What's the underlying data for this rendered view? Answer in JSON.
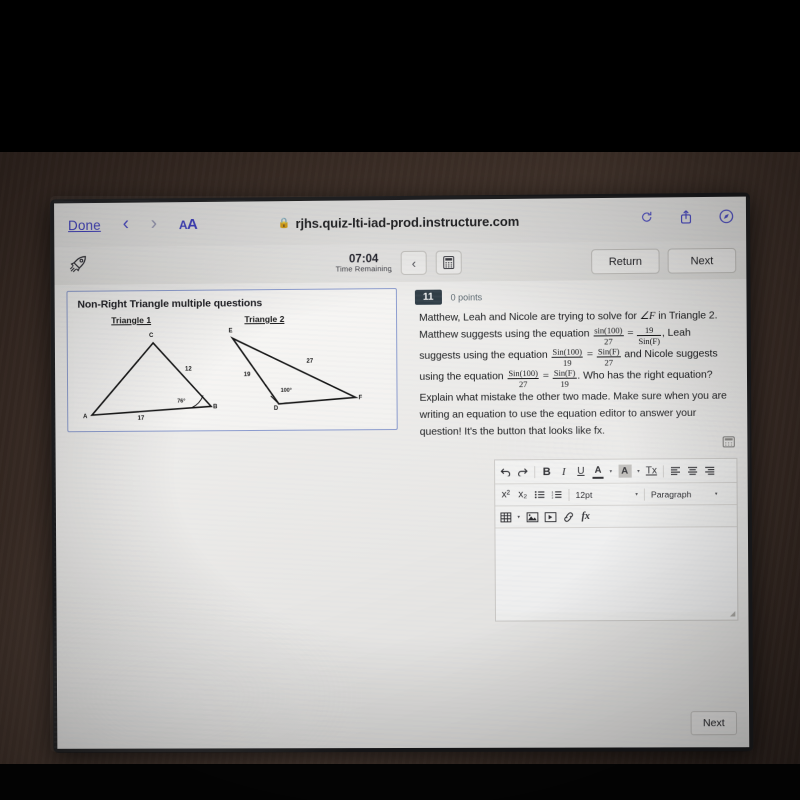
{
  "browser": {
    "done_label": "Done",
    "back_icon": "chevron-left-icon",
    "forward_icon": "chevron-right-icon",
    "text_size_label": "AA",
    "lock_icon": "lock-icon",
    "url": "rjhs.quiz-lti-iad-prod.instructure.com",
    "reload_icon": "reload-icon",
    "share_icon": "share-icon",
    "tabs_icon": "safari-compass-icon"
  },
  "quiz_bar": {
    "rocket_icon": "rocket-icon",
    "time_value": "07:04",
    "time_label": "Time Remaining",
    "collapse_icon": "chevron-left-icon",
    "calculator_icon": "calculator-icon",
    "return_label": "Return",
    "next_label": "Next"
  },
  "question_card": {
    "title": "Non-Right Triangle multiple questions",
    "figures": [
      {
        "label": "Triangle 1",
        "vertices": [
          "C",
          "A",
          "B"
        ],
        "sides": [
          "12",
          "17"
        ],
        "angles": [
          "76°"
        ]
      },
      {
        "label": "Triangle 2",
        "vertices": [
          "E",
          "D",
          "F"
        ],
        "sides": [
          "27",
          "19"
        ],
        "angles": [
          "100°"
        ]
      }
    ]
  },
  "question": {
    "number": "11",
    "points": "0 points",
    "line1_a": "Matthew, Leah and Nicole are trying to solve for ",
    "angle_symbol": "∠F",
    "line1_b": " in",
    "line2_a": "Triangle 2. Matthew suggests using the equation",
    "eq1": {
      "num1": "sin(100)",
      "den1": "27",
      "num2": "19",
      "den2": "Sin(F)"
    },
    "line3_a": ", Leah suggests using the equation",
    "eq2": {
      "num1": "Sin(100)",
      "den1": "19",
      "num2": "Sin(F)",
      "den2": "27"
    },
    "line4_a": "and Nicole suggests using the equation",
    "eq3": {
      "num1": "Sin(100)",
      "den1": "27",
      "num2": "Sin(F)",
      "den2": "19"
    },
    "line5": "Who has the right equation? Explain what mistake the other",
    "line6": "two made. Make sure when you are writing an equation to",
    "line7": "use the equation editor to answer your question! It's the",
    "line8": "button that looks like fx."
  },
  "editor": {
    "calculator_icon": "calculator-icon",
    "undo_icon": "undo-icon",
    "redo_icon": "redo-icon",
    "bold_label": "B",
    "italic_label": "I",
    "underline_label": "U",
    "text_color_label": "A",
    "text_color_caret": "▾",
    "highlight_label": "A",
    "highlight_caret": "▾",
    "clear_format_label": "Tx",
    "align_left_icon": "align-left-icon",
    "align_center_icon": "align-center-icon",
    "align_right_icon": "align-right-icon",
    "superscript_label": "x²",
    "subscript_label": "x₂",
    "bullet_list_icon": "bullet-list-icon",
    "number_list_icon": "numbered-list-icon",
    "font_size_value": "12pt",
    "font_size_caret": "▾",
    "paragraph_value": "Paragraph",
    "paragraph_caret": "▾",
    "table_icon": "table-icon",
    "table_caret": "▾",
    "image_icon": "image-icon",
    "media_icon": "media-icon",
    "link_icon": "link-icon",
    "equation_label": "fx",
    "textarea_value": "",
    "resize_icon": "resize-handle-icon"
  },
  "footer": {
    "next_label": "Next"
  }
}
